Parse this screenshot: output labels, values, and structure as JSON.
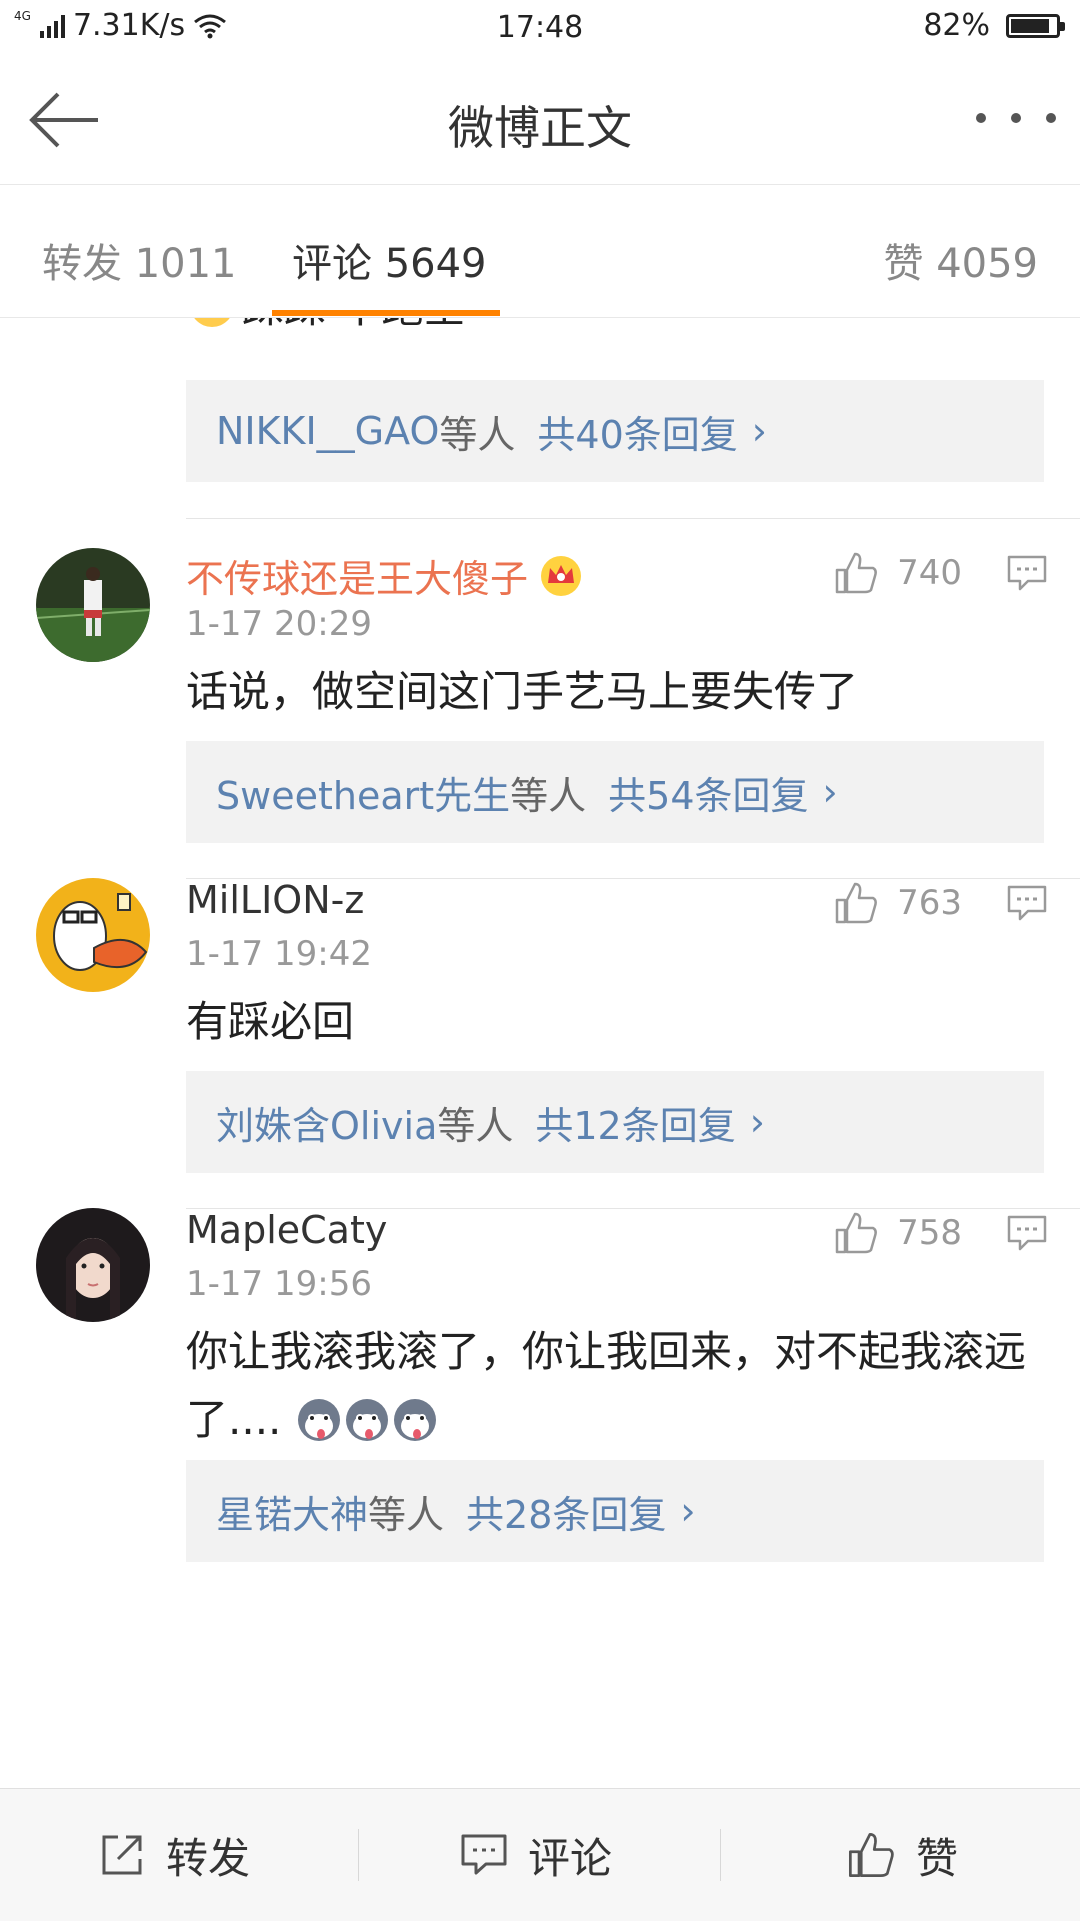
{
  "status_bar": {
    "network": "4G",
    "speed": "7.31K/s",
    "time": "17:48",
    "battery": "82%"
  },
  "nav": {
    "title": "微博正文"
  },
  "tabs": {
    "forward": "转发 1011",
    "comment": "评论 5649",
    "like": "赞 4059"
  },
  "partial_comment": {
    "text": "踩踩 不跑空",
    "replies": {
      "user": "NIKKI__GAO",
      "suffix": "等人",
      "count": "共40条回复"
    }
  },
  "comments": [
    {
      "name": "不传球还是王大傻子",
      "time": "1-17 20:29",
      "likes": "740",
      "text": "话说，做空间这门手艺马上要失传了",
      "replies": {
        "user": "Sweetheart先生",
        "suffix": "等人",
        "count": "共54条回复"
      }
    },
    {
      "name": "MilLION-z",
      "time": "1-17 19:42",
      "likes": "763",
      "text": "有踩必回",
      "replies": {
        "user": "刘姝含Olivia",
        "suffix": "等人",
        "count": "共12条回复"
      }
    },
    {
      "name": "MapleCaty",
      "time": "1-17 19:56",
      "likes": "758",
      "text": "你让我滚我滚了，你让我回来，对不起我滚远了....",
      "replies": {
        "user": "星锘大神",
        "suffix": "等人",
        "count": "共28条回复"
      }
    }
  ],
  "bottom_bar": {
    "forward": "转发",
    "comment": "评论",
    "like": "赞"
  },
  "colors": {
    "accent": "#ff8200",
    "vip_name": "#eb7350",
    "link": "#5c82b0",
    "reply_bg": "#f2f2f2"
  }
}
